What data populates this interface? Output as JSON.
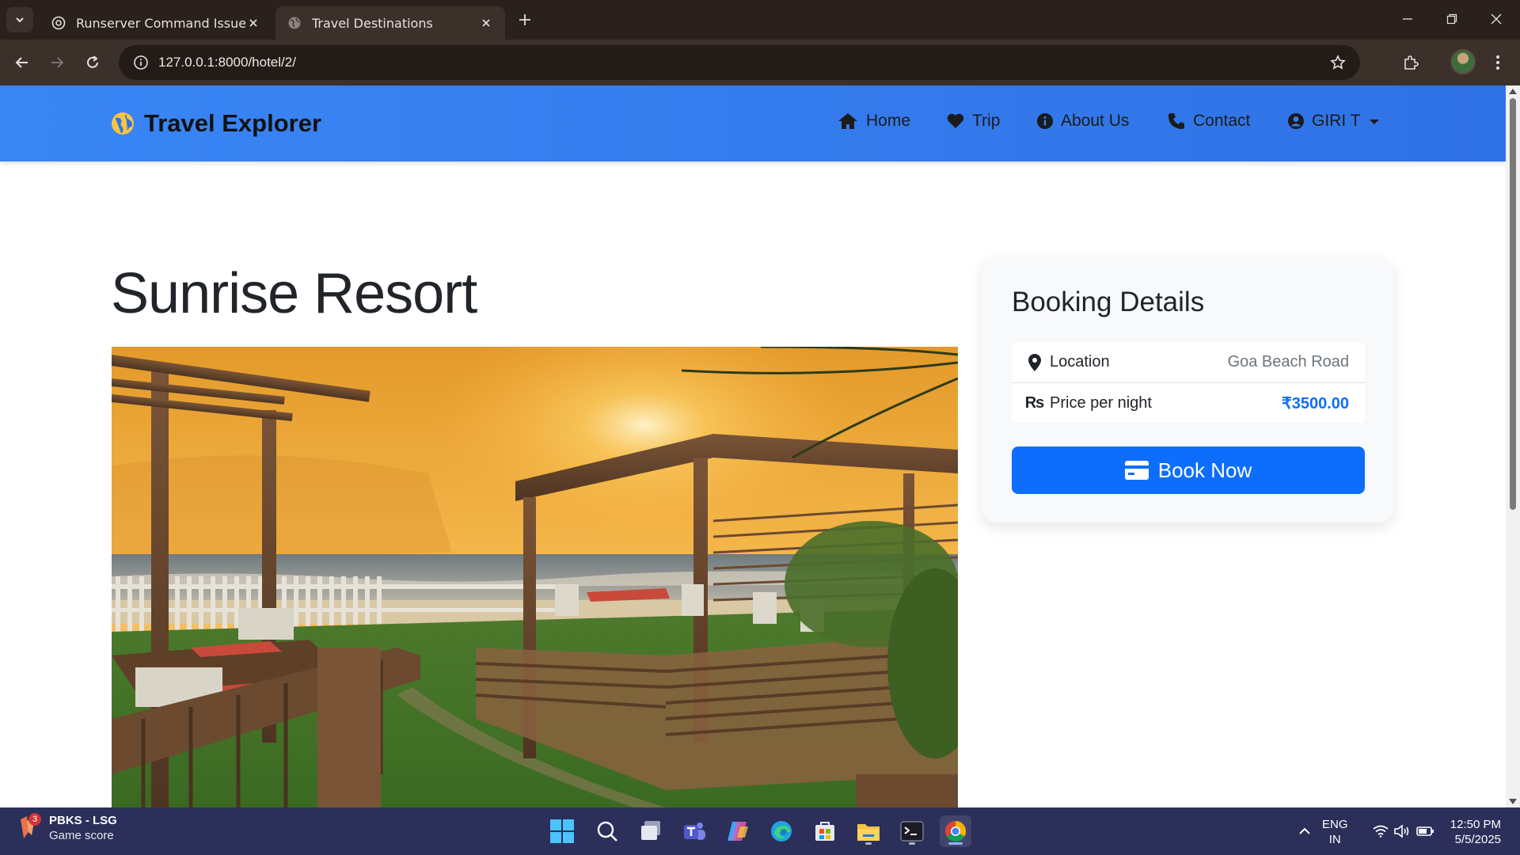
{
  "browser": {
    "tabs": [
      {
        "title": "Runserver Command Issue",
        "active": false,
        "favicon": "openai-icon"
      },
      {
        "title": "Travel Destinations",
        "active": true,
        "favicon": "globe-icon"
      }
    ],
    "url": "127.0.0.1:8000/hotel/2/"
  },
  "navbar": {
    "brand": "Travel Explorer",
    "items": [
      {
        "label": "Home",
        "icon": "home-icon"
      },
      {
        "label": "Trip",
        "icon": "heart-icon"
      },
      {
        "label": "About Us",
        "icon": "info-icon"
      },
      {
        "label": "Contact",
        "icon": "phone-icon"
      },
      {
        "label": "GIRI T",
        "icon": "user-circle-icon"
      }
    ]
  },
  "hotel": {
    "name": "Sunrise Resort"
  },
  "booking": {
    "heading": "Booking Details",
    "location_label": "Location",
    "location_value": "Goa Beach Road",
    "price_label": "Price per night",
    "price_value": "₹3500.00",
    "button_label": "Book Now"
  },
  "taskbar": {
    "widget_title": "PBKS - LSG",
    "widget_subtitle": "Game score",
    "widget_badge": "3",
    "lang_line1": "ENG",
    "lang_line2": "IN",
    "time": "12:50 PM",
    "date": "5/5/2025"
  },
  "colors": {
    "navbar": "#3a86f5",
    "primary": "#0d6efd",
    "taskbar": "#2b2f5a",
    "chrome": "#3c302b"
  }
}
